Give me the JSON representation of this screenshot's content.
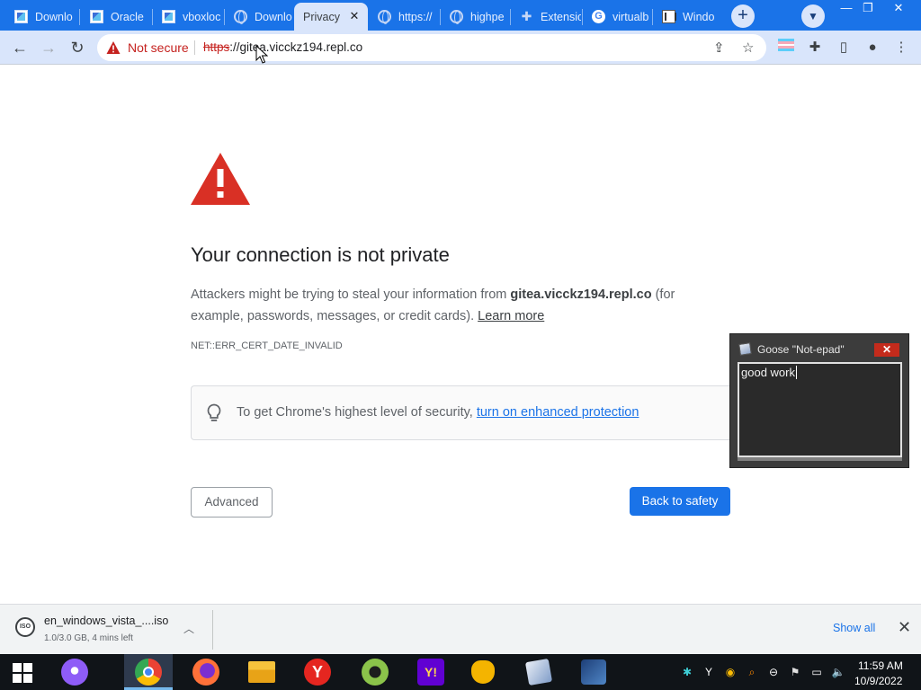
{
  "tabs": [
    {
      "title": "Downlo",
      "icon": "vbox-doc-icon"
    },
    {
      "title": "Oracle",
      "icon": "vbox-doc-icon"
    },
    {
      "title": "vboxloc",
      "icon": "vbox-doc-icon"
    },
    {
      "title": "Downlo",
      "icon": "globe-icon"
    },
    {
      "title": "Privacy e",
      "icon": "none",
      "active": true
    },
    {
      "title": "https://",
      "icon": "globe-icon"
    },
    {
      "title": "highpe",
      "icon": "globe-icon"
    },
    {
      "title": "Extensio",
      "icon": "puzzle-icon"
    },
    {
      "title": "virtualb",
      "icon": "google-icon"
    },
    {
      "title": "Windo",
      "icon": "window-icon"
    }
  ],
  "omnibox": {
    "security_label": "Not secure",
    "url_scheme": "https",
    "url_rest": "://gitea.vicckz194.repl.co"
  },
  "page": {
    "heading": "Your connection is not private",
    "explain_pre": "Attackers might be trying to steal your information from ",
    "explain_host": "gitea.vicckz194.repl.co",
    "explain_post": " (for example, passwords, messages, or credit cards). ",
    "learn_more": "Learn more",
    "error_code": "NET::ERR_CERT_DATE_INVALID",
    "enhanced_text": "To get Chrome's highest level of security, ",
    "enhanced_link": "turn on enhanced protection",
    "advanced_label": "Advanced",
    "back_label": "Back to safety"
  },
  "goose": {
    "title": "Goose \"Not-epad\"",
    "text": "good work"
  },
  "download": {
    "icon_label": "ISO",
    "filename": "en_windows_vista_....iso",
    "status": "1.0/3.0 GB, 4 mins left",
    "show_all": "Show all"
  },
  "taskbar": {
    "time": "11:59 AM",
    "date": "10/9/2022"
  },
  "colors": {
    "tabstrip": "#1a73e8",
    "toolbar": "#d9e5fb",
    "danger_red": "#c5221f",
    "link_blue": "#1a73e8",
    "primary_button": "#1a73e8",
    "taskbar": "#101418"
  }
}
